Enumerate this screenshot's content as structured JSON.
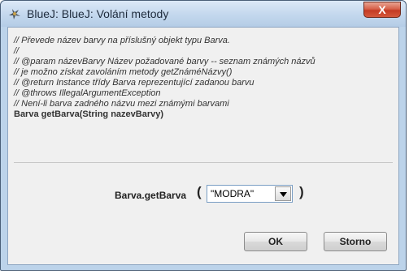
{
  "window": {
    "title": "BlueJ:  BlueJ:  Volání metody",
    "close_glyph": "X"
  },
  "comment_lines": [
    "// Převede název barvy na příslušný objekt typu Barva.",
    "//",
    "// @param názevBarvy  Název požadované barvy -- seznam známých názvů",
    "// je možno získat zavoláním metody getZnáméNázvy()",
    "// @return Instance třídy Barva reprezentující zadanou barvu",
    "// @throws IllegalArgumentException",
    "// Není-li barva zadného názvu mezi známými barvami"
  ],
  "signature": "Barva getBarva(String nazevBarvy)",
  "call": {
    "method_label": "Barva.getBarva",
    "open_paren": "(",
    "close_paren": ")",
    "argument_value": "\"MODRA\""
  },
  "buttons": {
    "ok": "OK",
    "cancel": "Storno"
  }
}
